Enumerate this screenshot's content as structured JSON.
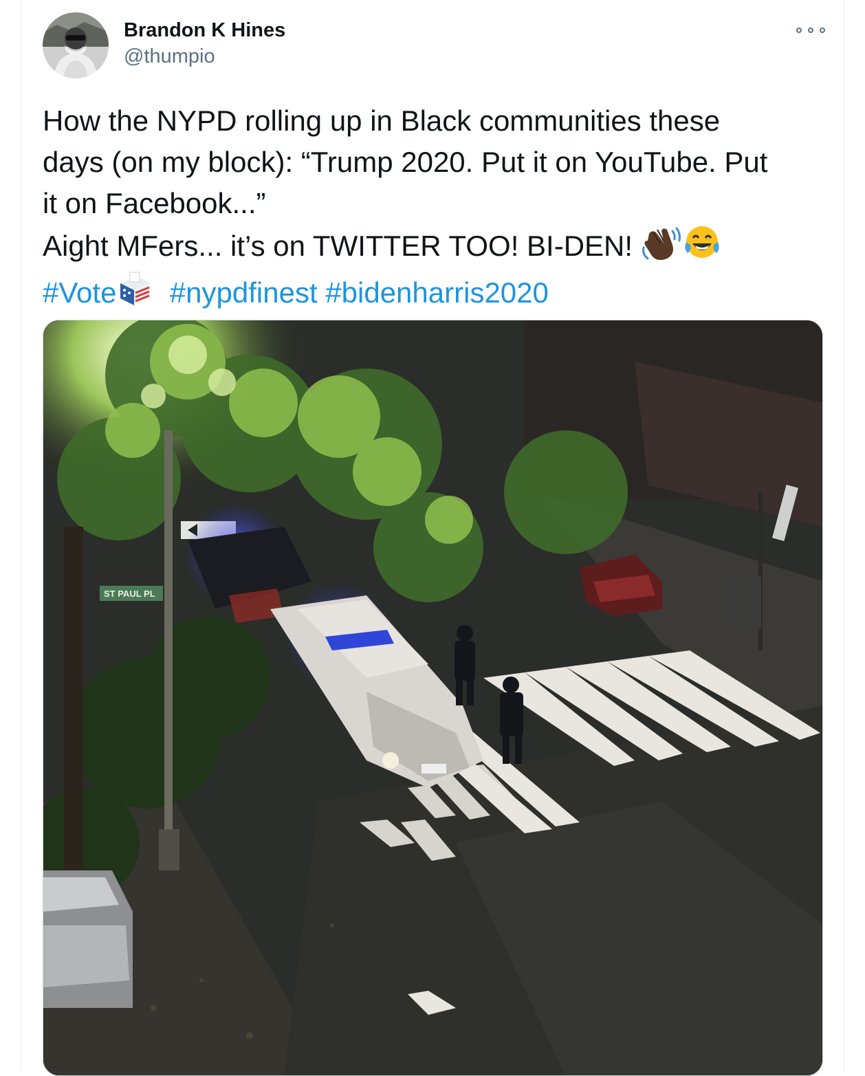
{
  "tweet": {
    "author_name": "Brandon K Hines",
    "author_handle": "@thumpio",
    "text_lines": [
      "How the NYPD rolling up in Black communities these",
      "days (on my block): “Trump 2020. Put it on YouTube. Put",
      "it on Facebook...”"
    ],
    "line4_text": "Aight MFers... it’s on TWITTER TOO! BI-DEN!",
    "hashtags": [
      "#Vote",
      "#nypdfinest",
      "#bidenharris2020"
    ],
    "emojis": [
      "waving-hand-dark-skin-tone",
      "face-with-tears-of-joy",
      "ballot-box-flag"
    ],
    "media": {
      "sign_text": "ST PAUL PL"
    }
  },
  "colors": {
    "link": "#1b95e0",
    "secondary_text": "#5b7083",
    "primary_text": "#0f1419",
    "border": "#ccd6dd"
  },
  "icons": {
    "more": "more-options-icon"
  }
}
